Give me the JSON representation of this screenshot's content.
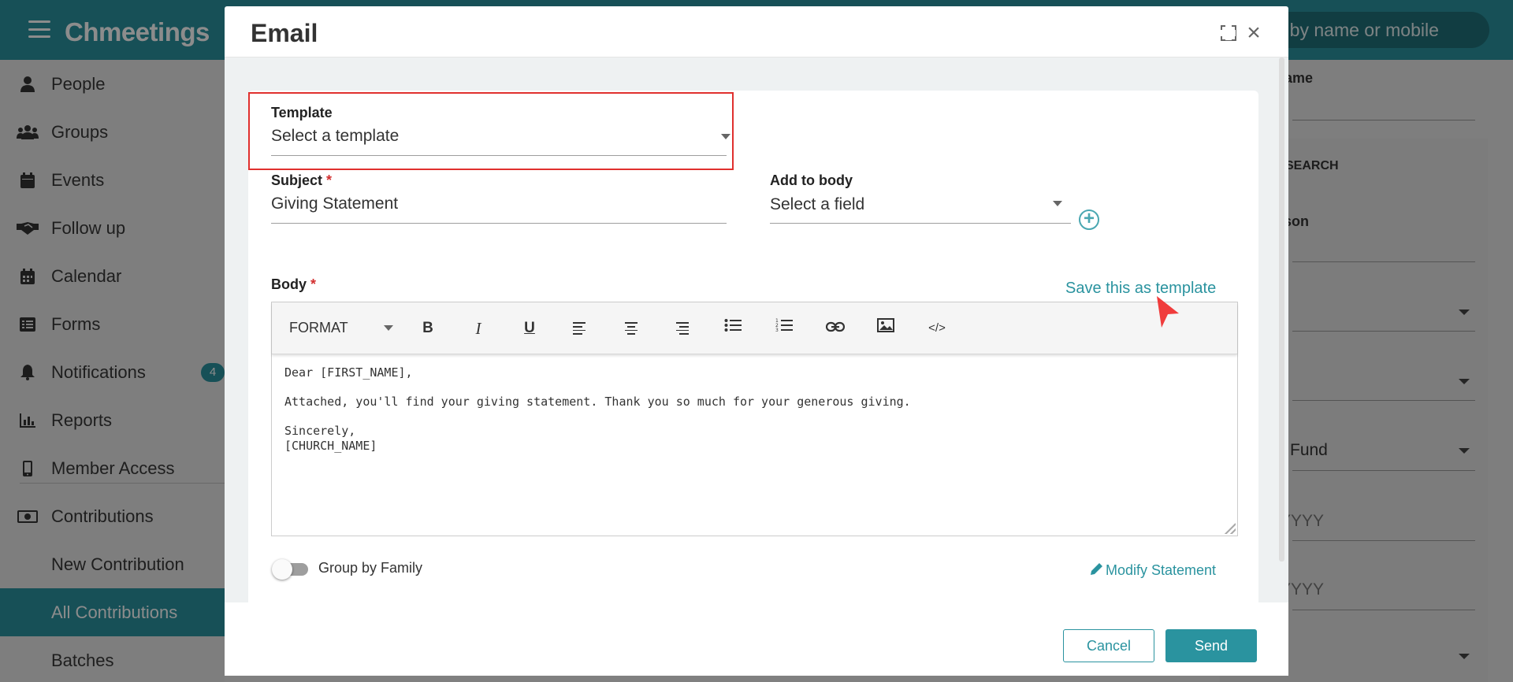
{
  "app": {
    "logo": "Chmeetings",
    "search_placeholder": "Search by name or mobile",
    "search_visible": "ch by name or mobile"
  },
  "sidebar": {
    "items": [
      {
        "label": "People",
        "icon": "person-icon"
      },
      {
        "label": "Groups",
        "icon": "groups-icon"
      },
      {
        "label": "Events",
        "icon": "calendar-icon"
      },
      {
        "label": "Follow up",
        "icon": "handshake-icon"
      },
      {
        "label": "Calendar",
        "icon": "calendar-grid-icon"
      },
      {
        "label": "Forms",
        "icon": "list-icon"
      },
      {
        "label": "Notifications",
        "icon": "bell-icon",
        "badge": "4"
      },
      {
        "label": "Reports",
        "icon": "bar-chart-icon"
      },
      {
        "label": "Member Access",
        "icon": "mobile-icon"
      },
      {
        "label": "Contributions",
        "icon": "money-icon"
      }
    ],
    "sub_items": [
      {
        "label": "New Contribution"
      },
      {
        "label": "All Contributions",
        "active": true
      },
      {
        "label": "Batches"
      }
    ]
  },
  "right_panel": {
    "name_label": "ame",
    "search_label": "D SEARCH",
    "person_label": "rson",
    "fund_value": "Fund",
    "date_from": "YYYY",
    "date_to": "YYYY"
  },
  "modal": {
    "title": "Email",
    "template": {
      "label": "Template",
      "value": "Select a template"
    },
    "subject": {
      "label": "Subject",
      "required": "*",
      "value": "Giving Statement"
    },
    "add_to_body": {
      "label": "Add to body",
      "value": "Select a field"
    },
    "body": {
      "label": "Body",
      "required": "*",
      "save_template_link": "Save this as template",
      "toolbar": {
        "format_label": "FORMAT",
        "buttons": [
          "bold-icon",
          "italic-icon",
          "underline-icon",
          "align-left-icon",
          "align-center-icon",
          "align-right-icon",
          "bullet-list-icon",
          "numbered-list-icon",
          "link-icon",
          "image-icon",
          "code-icon"
        ]
      },
      "content": {
        "greeting": "Dear [FIRST_NAME],",
        "message": "Attached, you'll find your giving statement. Thank you so much for your generous giving.",
        "closing": "Sincerely,",
        "signature": "[CHURCH_NAME]"
      }
    },
    "group_by_family": {
      "label": "Group by Family",
      "checked": false
    },
    "modify_statement_link": "Modify Statement",
    "footer": {
      "cancel_label": "Cancel",
      "send_label": "Send"
    }
  },
  "colors": {
    "accent": "#2a939f",
    "highlight_border": "#e0302e",
    "required": "#d32f2f"
  }
}
